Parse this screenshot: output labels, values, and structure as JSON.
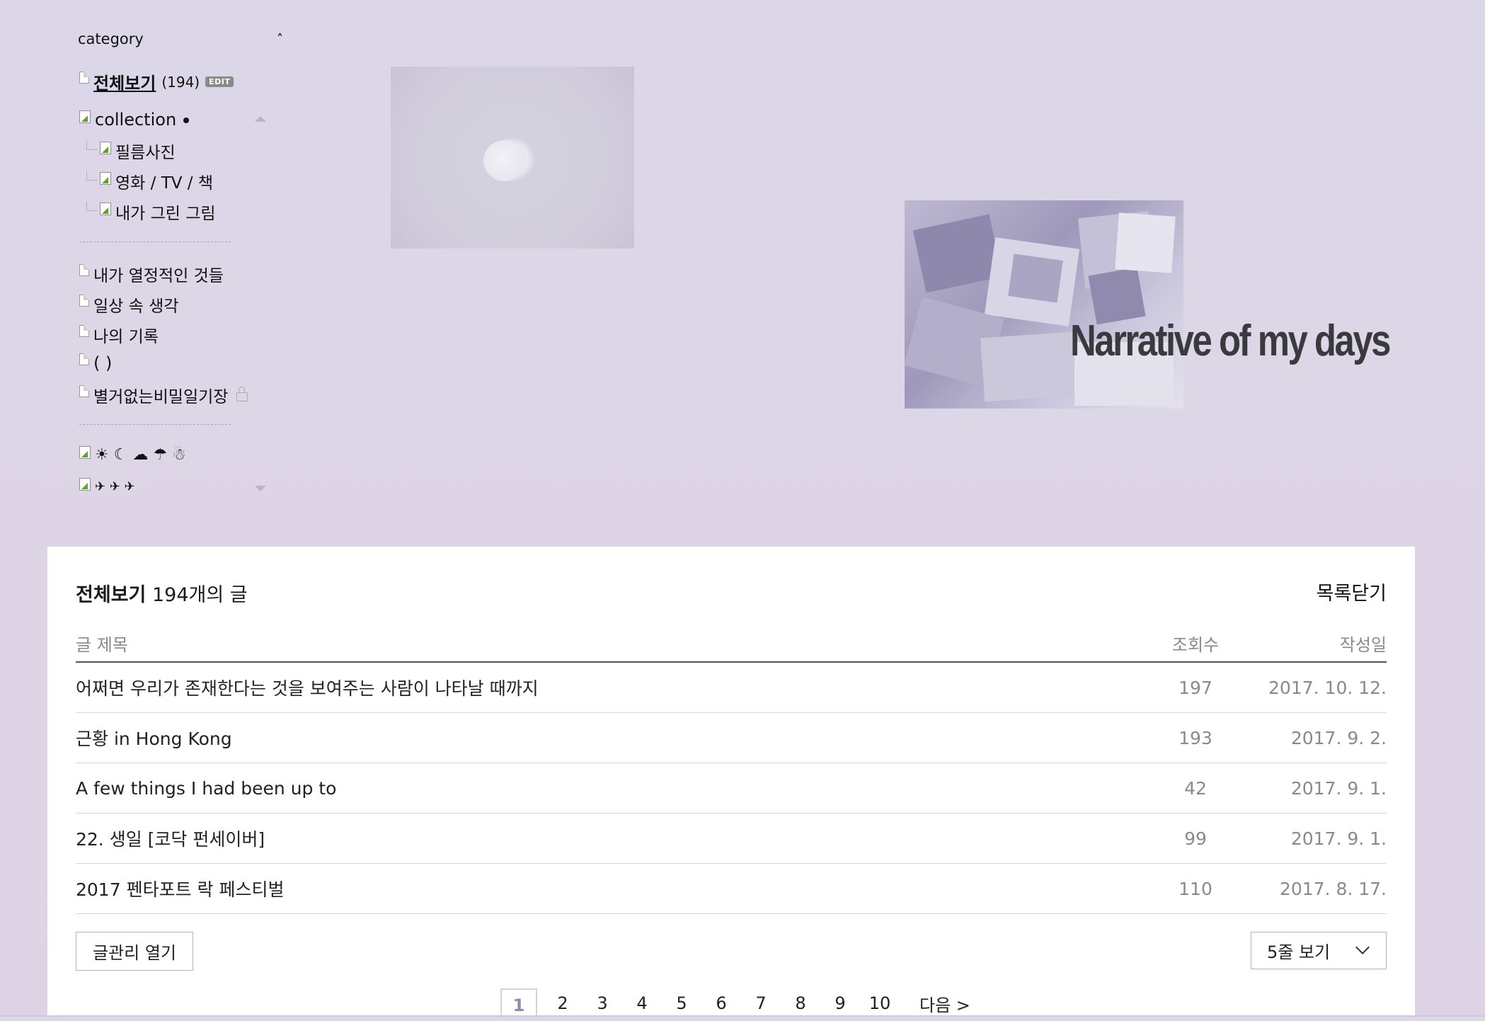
{
  "sidebar": {
    "title": "category",
    "collapse_icon": "caret-up-icon",
    "all": {
      "label": "전체보기",
      "count": "(194)",
      "badge": "EDIT"
    },
    "items": [
      {
        "label": "collection",
        "icon": "image-icon"
      },
      {
        "label": "필름사진",
        "icon": "image-icon"
      },
      {
        "label": "영화 / TV / 책",
        "icon": "image-icon"
      },
      {
        "label": "내가 그린 그림",
        "icon": "image-icon"
      },
      {
        "label": "내가 열정적인 것들",
        "icon": "document-icon"
      },
      {
        "label": "일상 속 생각",
        "icon": "document-icon"
      },
      {
        "label": "나의 기록",
        "icon": "document-icon"
      },
      {
        "label": "( )",
        "icon": "document-icon"
      },
      {
        "label": "별거없는비밀일기장",
        "icon": "document-icon"
      },
      {
        "label": "☀ ☾ ☁ ☂ ☃",
        "icon": "image-icon"
      },
      {
        "label": "✈ ✈ ✈",
        "icon": "image-icon"
      }
    ]
  },
  "banner": {
    "text": "Narrative of my days"
  },
  "list": {
    "heading_bold": "전체보기",
    "heading_count": "194개의 글",
    "close_label": "목록닫기",
    "columns": {
      "title": "글 제목",
      "views": "조회수",
      "date": "작성일"
    },
    "rows": [
      {
        "title": "어쩌면 우리가 존재한다는 것을 보여주는 사람이 나타날 때까지",
        "views": "197",
        "date": "2017. 10. 12."
      },
      {
        "title": "근황 in Hong Kong",
        "views": "193",
        "date": "2017. 9. 2."
      },
      {
        "title": "A few things I had been up to",
        "views": "42",
        "date": "2017. 9. 1."
      },
      {
        "title": "22. 생일 [코닥 펀세이버]",
        "views": "99",
        "date": "2017. 9. 1."
      },
      {
        "title": "2017 펜타포트 락 페스티벌",
        "views": "110",
        "date": "2017. 8. 17."
      }
    ],
    "manage_label": "글관리 열기",
    "rows_select": "5줄 보기",
    "pages": [
      "1",
      "2",
      "3",
      "4",
      "5",
      "6",
      "7",
      "8",
      "9",
      "10"
    ],
    "next_label": "다음 >"
  },
  "colors": {
    "background": "#dcd7e8",
    "panel": "#ffffff",
    "current_page": "#8e8aa8"
  }
}
